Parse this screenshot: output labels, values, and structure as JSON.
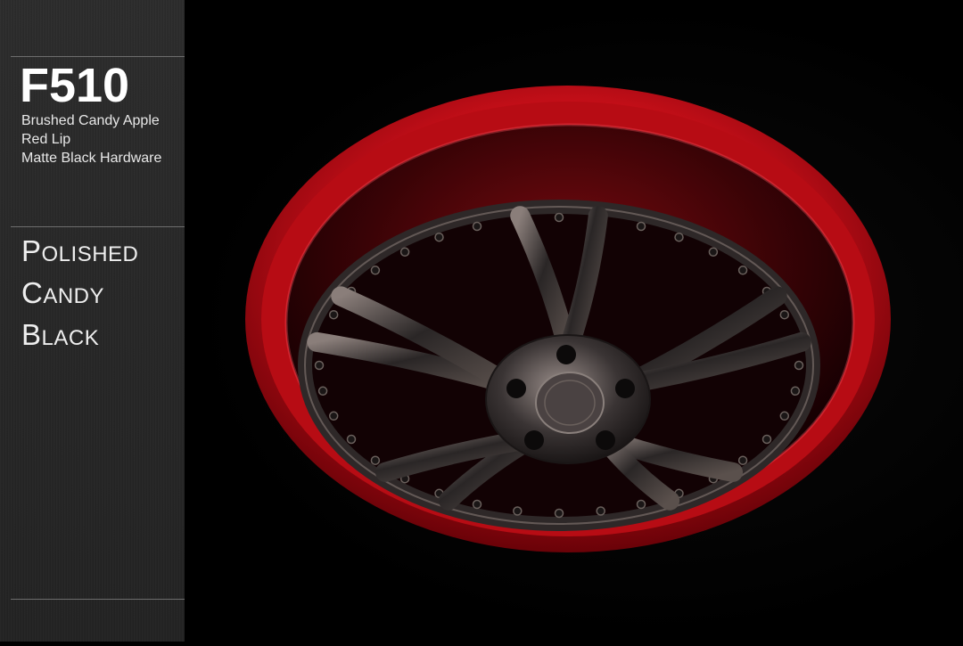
{
  "sidebar": {
    "model": "F510",
    "spec_lines": [
      "Brushed Candy Apple",
      "Red Lip",
      "Matte Black Hardware"
    ],
    "finish_words": [
      {
        "initial": "P",
        "rest": "OLISHED"
      },
      {
        "initial": "C",
        "rest": "ANDY"
      },
      {
        "initial": "B",
        "rest": "LACK"
      }
    ]
  },
  "photo": {
    "subject": "wheel-image",
    "colors": {
      "lip": "#d0101a",
      "lip_highlight": "#ff3a40",
      "spokes": "#2a2626",
      "spoke_highlight": "#8a7e7a",
      "background": "#000000"
    }
  }
}
